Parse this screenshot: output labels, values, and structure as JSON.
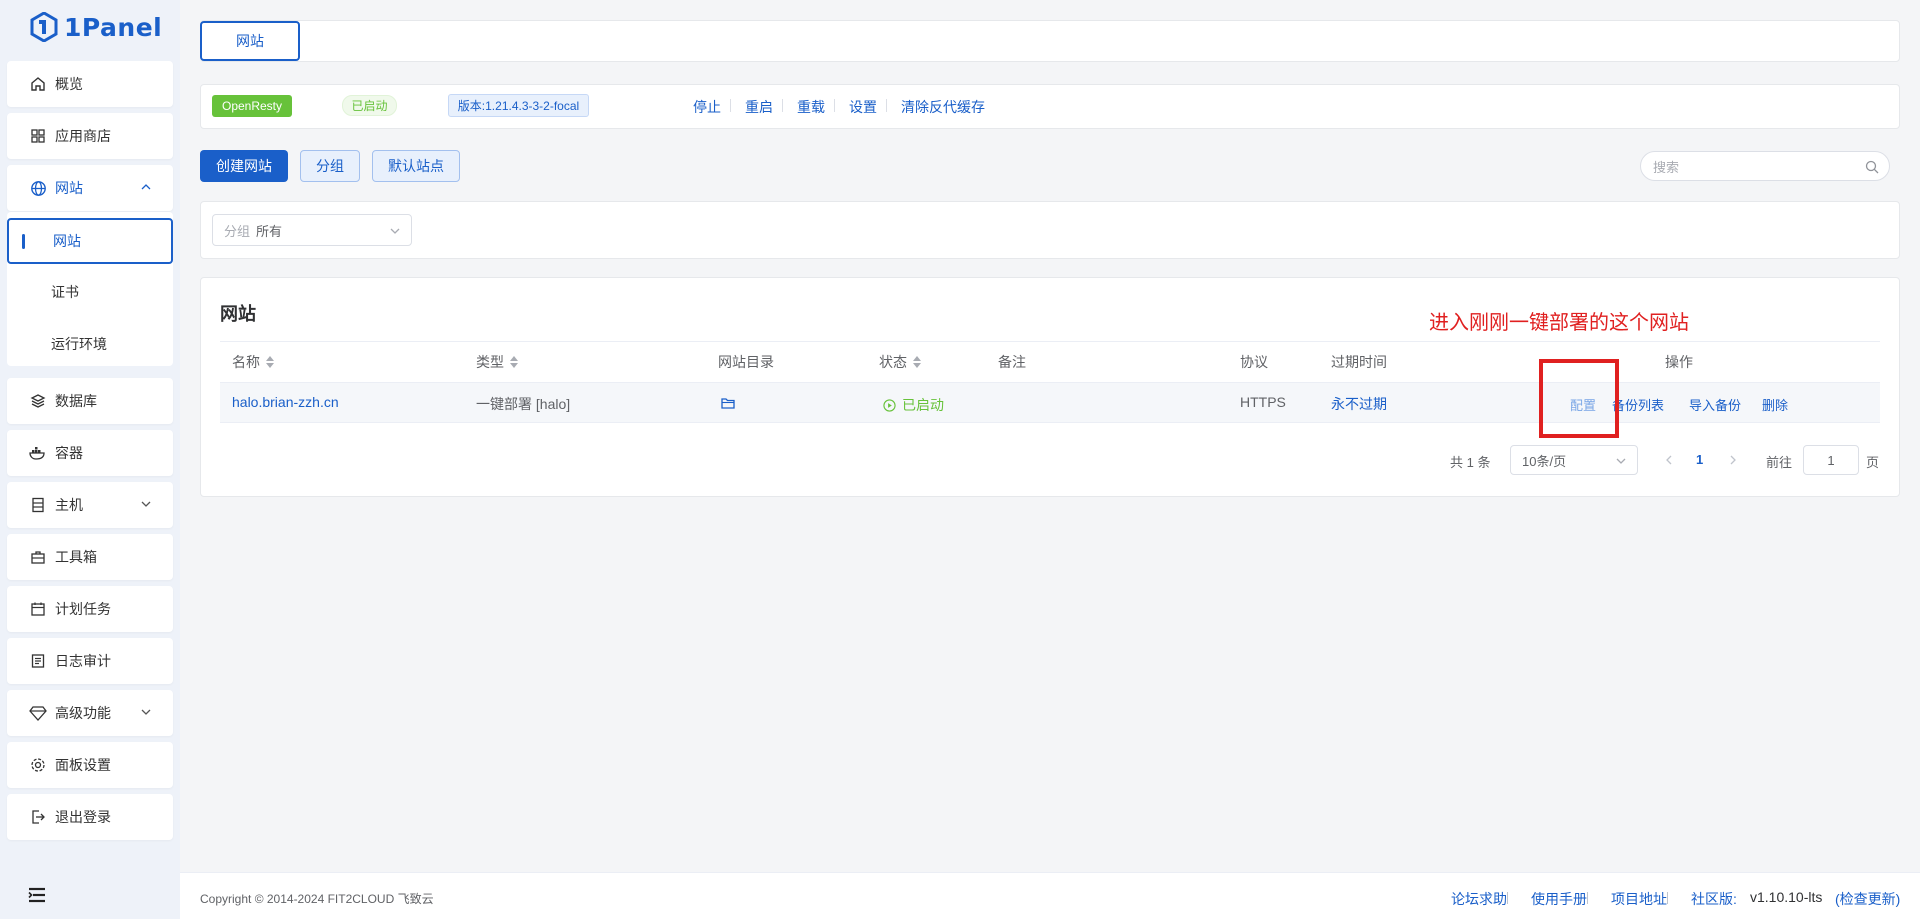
{
  "app": {
    "logo_text": "1Panel"
  },
  "sidebar": {
    "items": [
      {
        "label": "概览",
        "icon": "home-icon"
      },
      {
        "label": "应用商店",
        "icon": "grid-icon"
      },
      {
        "label": "网站",
        "icon": "globe-icon"
      },
      {
        "label": "数据库",
        "icon": "layers-icon"
      },
      {
        "label": "容器",
        "icon": "docker-icon"
      },
      {
        "label": "主机",
        "icon": "server-icon"
      },
      {
        "label": "工具箱",
        "icon": "toolbox-icon"
      },
      {
        "label": "计划任务",
        "icon": "calendar-icon"
      },
      {
        "label": "日志审计",
        "icon": "log-icon"
      },
      {
        "label": "高级功能",
        "icon": "diamond-icon"
      },
      {
        "label": "面板设置",
        "icon": "gear-icon"
      },
      {
        "label": "退出登录",
        "icon": "logout-icon"
      }
    ],
    "sub_items": [
      "网站",
      "证书",
      "运行环境"
    ]
  },
  "top_tab": {
    "label": "网站"
  },
  "status_bar": {
    "app_name": "OpenResty",
    "status": "已启动",
    "version": "版本:1.21.4.3-3-2-focal",
    "actions": [
      "停止",
      "重启",
      "重载",
      "设置",
      "清除反代缓存"
    ]
  },
  "toolbar": {
    "create_label": "创建网站",
    "group_label": "分组",
    "default_site_label": "默认站点",
    "search_placeholder": "搜索"
  },
  "filter": {
    "label": "分组",
    "value": "所有"
  },
  "table": {
    "title": "网站",
    "headers": [
      "名称",
      "类型",
      "网站目录",
      "状态",
      "备注",
      "协议",
      "过期时间",
      "操作"
    ],
    "rows": [
      {
        "name": "halo.brian-zzh.cn",
        "type": "一键部署 [halo]",
        "status": "已启动",
        "remark": "",
        "protocol": "HTTPS",
        "expire": "永不过期",
        "actions": [
          "配置",
          "备份列表",
          "导入备份",
          "删除"
        ]
      }
    ]
  },
  "pagination": {
    "total": "共 1 条",
    "page_size": "10条/页",
    "current": "1",
    "goto_label": "前往",
    "goto_value": "1",
    "page_suffix": "页"
  },
  "annotation": {
    "text": "进入刚刚一键部署的这个网站"
  },
  "footer": {
    "copyright": "Copyright © 2014-2024 FIT2CLOUD 飞致云",
    "links": [
      "论坛求助",
      "使用手册",
      "项目地址"
    ],
    "edition_label": "社区版:",
    "version": "v1.10.10-lts",
    "check_update": "(检查更新)"
  },
  "colors": {
    "primary": "#1a5fc9",
    "success": "#67c23a",
    "annotation": "#e02020"
  }
}
